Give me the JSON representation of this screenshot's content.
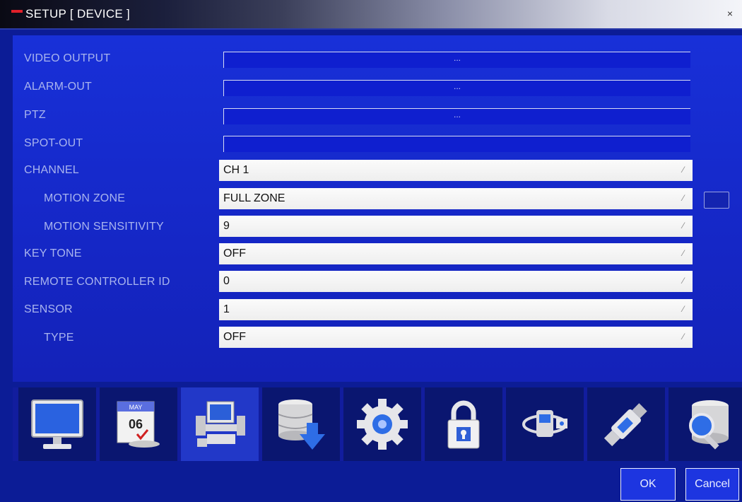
{
  "window": {
    "title": "SETUP [ DEVICE ]",
    "close_glyph": "×"
  },
  "rows": [
    {
      "label": "VIDEO OUTPUT",
      "value": "...",
      "kind": "button"
    },
    {
      "label": "ALARM-OUT",
      "value": "...",
      "kind": "button"
    },
    {
      "label": "PTZ",
      "value": "...",
      "kind": "button"
    },
    {
      "label": "SPOT-OUT",
      "value": "",
      "kind": "button"
    },
    {
      "label": "CHANNEL",
      "value": "CH 1",
      "kind": "select"
    },
    {
      "label": "MOTION ZONE",
      "value": "FULL ZONE",
      "kind": "select"
    },
    {
      "label": "MOTION SENSITIVITY",
      "value": "9",
      "kind": "select"
    },
    {
      "label": "KEY TONE",
      "value": "OFF",
      "kind": "select"
    },
    {
      "label": "REMOTE CONTROLLER ID",
      "value": "0",
      "kind": "select"
    },
    {
      "label": "SENSOR",
      "value": "1",
      "kind": "select"
    },
    {
      "label": "TYPE",
      "value": "OFF",
      "kind": "select"
    }
  ],
  "icons": [
    {
      "name": "monitor-icon"
    },
    {
      "name": "calendar-icon",
      "month": "MAY",
      "day": "06"
    },
    {
      "name": "device-icon",
      "selected": true
    },
    {
      "name": "storage-download-icon"
    },
    {
      "name": "gear-icon"
    },
    {
      "name": "lock-icon"
    },
    {
      "name": "network-icon"
    },
    {
      "name": "usb-icon"
    },
    {
      "name": "search-database-icon"
    }
  ],
  "buttons": {
    "ok": "OK",
    "cancel": "Cancel"
  },
  "colors": {
    "background": "#0c1c96",
    "panel": "#1830d8",
    "label": "#a9b4ee",
    "field_bg": "#f2f2f2",
    "title_accent": "#e0202a"
  }
}
